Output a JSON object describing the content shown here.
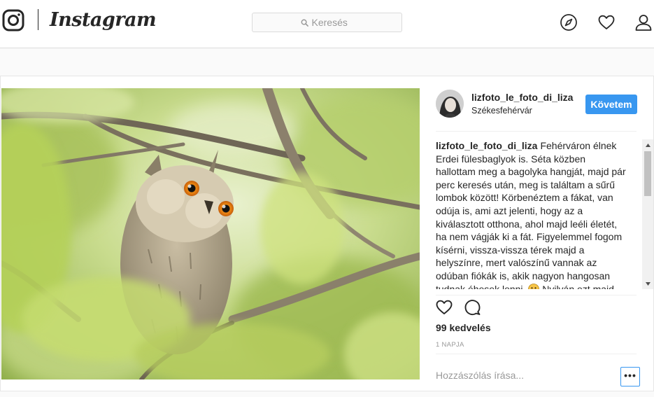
{
  "nav": {
    "brand": "Instagram",
    "search_placeholder": "Keresés",
    "icons": [
      "instagram-logo-icon",
      "search-icon",
      "compass-icon",
      "heart-icon",
      "profile-icon"
    ]
  },
  "post": {
    "username": "lizfoto_le_foto_di_liza",
    "location": "Székesfehérvár",
    "follow_label": "Követem",
    "caption_user": "lizfoto_le_foto_di_liza",
    "caption_text": "Fehérváron élnek Erdei fülesbaglyok is. Séta közben hallottam meg a bagolyka hangját, majd pár perc keresés után, meg is találtam a sűrű lombok között! Körbenéztem a fákat, van odúja is, ami azt jelenti, hogy az a kiválasztott otthona, ahol majd leéli életét, ha nem vágják ki a fát. Figyelemmel fogom kísérni, vissza-vissza térek majd a helyszínre, mert valószínű vannak az odúban fiókák is, akik nagyon hangosan tudnak éhesek lenni.",
    "caption_after_emoji": "Nyilván ezt majd",
    "likes": "99 kedvelés",
    "timestamp": "1 NAPJA",
    "comment_placeholder": "Hozzászólás írása...",
    "more_label": "•••"
  },
  "colors": {
    "accent": "#3897f0",
    "border": "#dbdbdb",
    "text": "#262626",
    "muted": "#999999"
  }
}
